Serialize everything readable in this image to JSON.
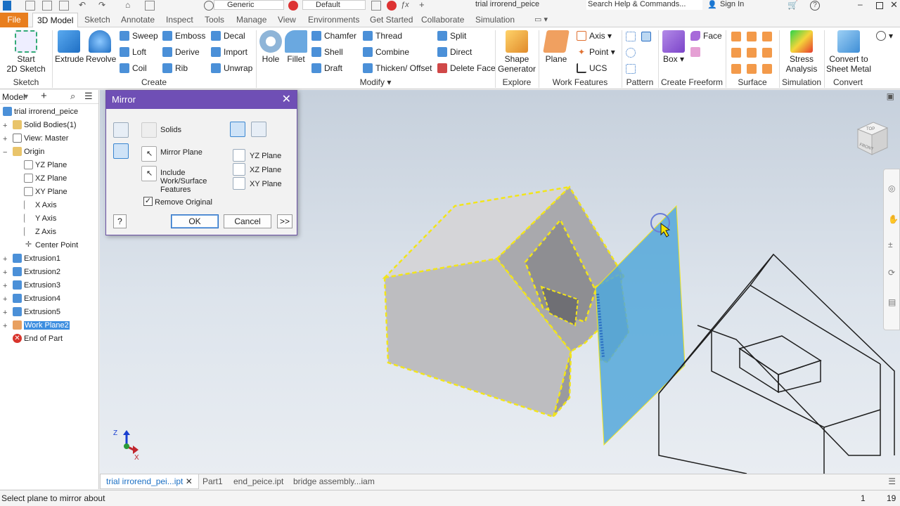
{
  "app": {
    "document_title": "trial irrorend_peice",
    "search_placeholder": "Search Help & Commands...",
    "sign_in": "Sign In",
    "appearance_combo": "Generic",
    "style_combo": "Default"
  },
  "tabs": [
    "File",
    "3D Model",
    "Sketch",
    "Annotate",
    "Inspect",
    "Tools",
    "Manage",
    "View",
    "Environments",
    "Get Started",
    "Collaborate",
    "Simulation"
  ],
  "active_tab": "3D Model",
  "ribbon": {
    "groups": {
      "sketch": "Sketch",
      "create": "Create",
      "modify": "Modify",
      "explore": "Explore",
      "work_features": "Work Features",
      "pattern": "Pattern",
      "create_freeform": "Create Freeform",
      "surface": "Surface",
      "simulation": "Simulation",
      "convert": "Convert"
    },
    "start_sketch": "Start\n2D Sketch",
    "extrude": "Extrude",
    "revolve": "Revolve",
    "sweep": "Sweep",
    "emboss": "Emboss",
    "decal": "Decal",
    "loft": "Loft",
    "derive": "Derive",
    "import": "Import",
    "coil": "Coil",
    "rib": "Rib",
    "unwrap": "Unwrap",
    "hole": "Hole",
    "fillet": "Fillet",
    "chamfer": "Chamfer",
    "thread": "Thread",
    "split": "Split",
    "shell": "Shell",
    "combine": "Combine",
    "direct": "Direct",
    "draft": "Draft",
    "thicken_offset": "Thicken/ Offset",
    "delete_face": "Delete Face",
    "shape_generator": "Shape\nGenerator",
    "plane": "Plane",
    "axis": "Axis",
    "point": "Point",
    "ucs": "UCS",
    "box": "Box",
    "face": "Face",
    "stress_analysis": "Stress\nAnalysis",
    "convert_sheet_metal": "Convert to\nSheet Metal"
  },
  "browser": {
    "header": "Model",
    "items": [
      {
        "label": "trial irrorend_peice",
        "icon": "part-icon"
      },
      {
        "label": "Solid Bodies(1)",
        "icon": "folder-icon"
      },
      {
        "label": "View: Master",
        "icon": "view-icon"
      },
      {
        "label": "Origin",
        "icon": "folder-icon"
      },
      {
        "label": "YZ Plane",
        "icon": "plane-icon"
      },
      {
        "label": "XZ Plane",
        "icon": "plane-icon"
      },
      {
        "label": "XY Plane",
        "icon": "plane-icon"
      },
      {
        "label": "X Axis",
        "icon": "axis-icon"
      },
      {
        "label": "Y Axis",
        "icon": "axis-icon"
      },
      {
        "label": "Z Axis",
        "icon": "axis-icon"
      },
      {
        "label": "Center Point",
        "icon": "point-icon"
      },
      {
        "label": "Extrusion1",
        "icon": "extrusion-icon"
      },
      {
        "label": "Extrusion2",
        "icon": "extrusion-icon"
      },
      {
        "label": "Extrusion3",
        "icon": "extrusion-icon"
      },
      {
        "label": "Extrusion4",
        "icon": "extrusion-icon"
      },
      {
        "label": "Extrusion5",
        "icon": "extrusion-icon"
      },
      {
        "label": "Work Plane2",
        "icon": "workplane-icon"
      },
      {
        "label": "End of Part",
        "icon": "end-of-part-icon"
      }
    ],
    "selected": "Work Plane2"
  },
  "dialog": {
    "title": "Mirror",
    "solids": "Solids",
    "mirror_plane": "Mirror Plane",
    "include_features": "Include\nWork/Surface\nFeatures",
    "remove_original": "Remove Original",
    "remove_original_checked": true,
    "yz_plane": "YZ Plane",
    "xz_plane": "XZ Plane",
    "xy_plane": "XY Plane",
    "ok": "OK",
    "cancel": "Cancel",
    "more": ">>",
    "help": "?"
  },
  "doc_tabs": [
    "trial irrorend_pei...ipt",
    "Part1",
    "end_peice.ipt",
    "bridge assembly...iam"
  ],
  "active_doc_tab": "trial irrorend_pei...ipt",
  "status": {
    "message": "Select plane to mirror about",
    "count1": "1",
    "count2": "19"
  },
  "triad": {
    "z": "Z",
    "x": "X"
  },
  "viewcube": {
    "top": "TOP",
    "front": "FRONT"
  }
}
